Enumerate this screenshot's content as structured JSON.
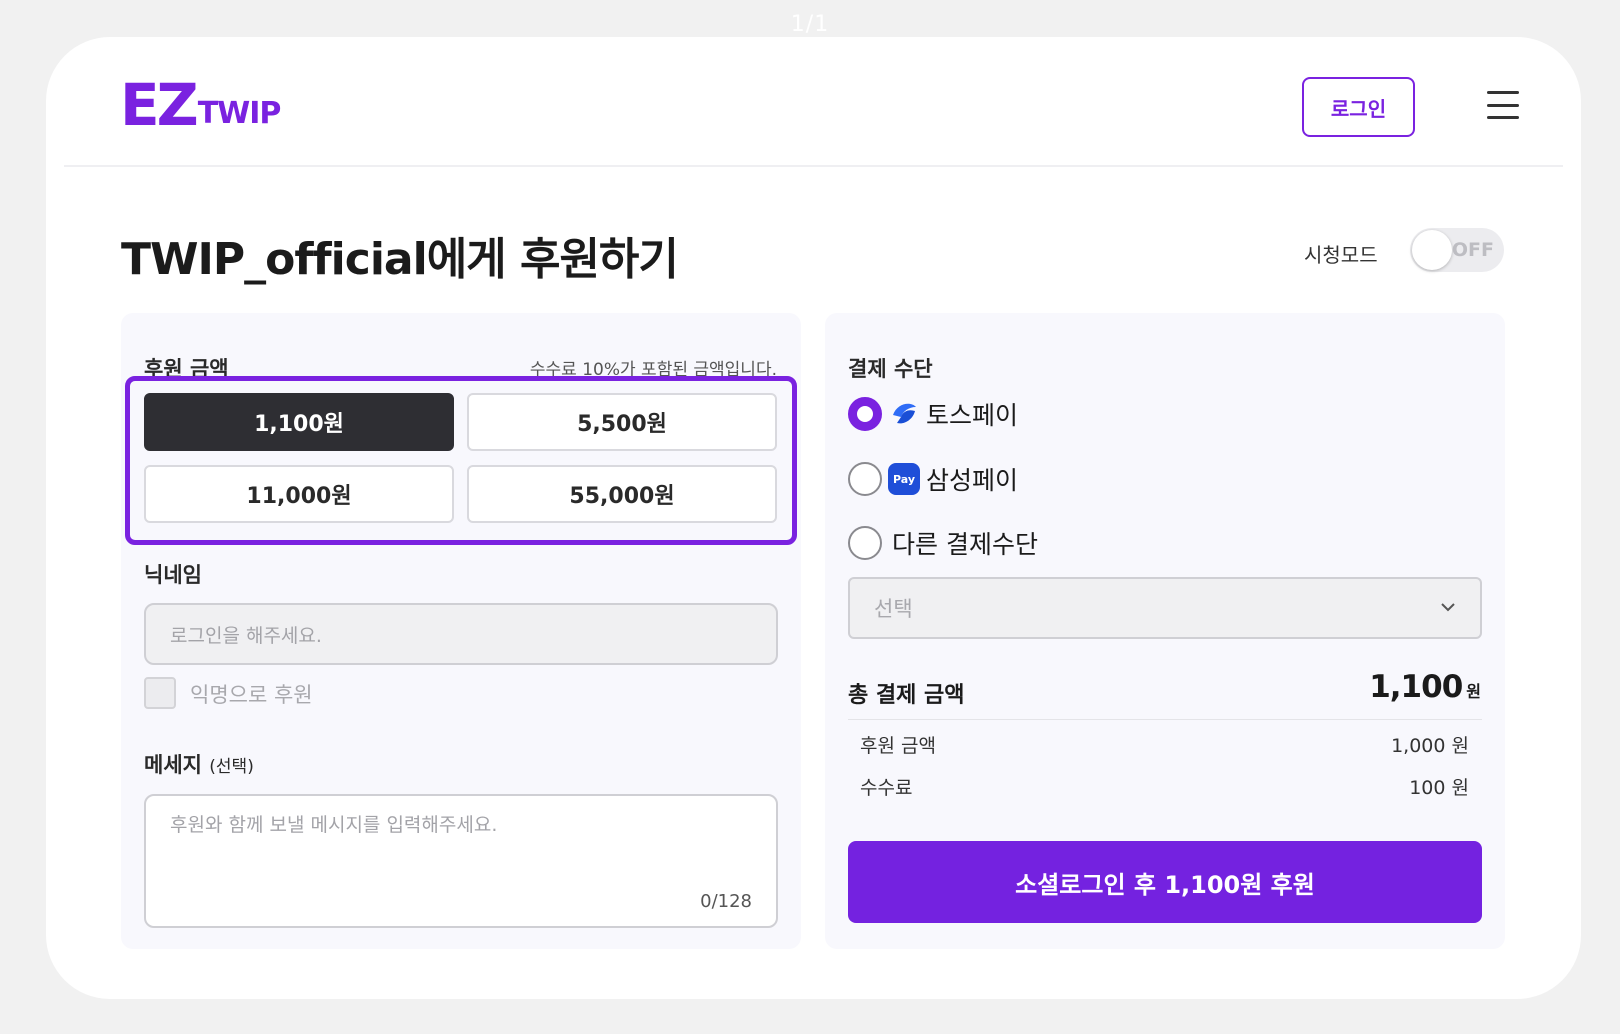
{
  "page_indicator": "1/1",
  "header": {
    "logo_big": "EZ",
    "logo_small": "TWIP",
    "login_label": "로그인"
  },
  "title": "TWIP_official에게 후원하기",
  "viewer_mode": {
    "label": "시청모드",
    "state": "OFF"
  },
  "donation": {
    "amount_label": "후원 금액",
    "fee_note": "수수료 10%가 포함된 금액입니다.",
    "amounts": [
      "1,100원",
      "5,500원",
      "11,000원",
      "55,000원"
    ],
    "selected_index": 0
  },
  "nickname": {
    "label": "닉네임",
    "placeholder": "로그인을 해주세요.",
    "anonymous_label": "익명으로 후원"
  },
  "message": {
    "label": "메세지",
    "optional": "(선택)",
    "placeholder": "후원와 함께 보낼 메시지를 입력해주세요.",
    "char_count": "0/128"
  },
  "payment": {
    "label": "결제 수단",
    "methods": [
      {
        "label": "토스페이",
        "icon": "toss-icon",
        "checked": true
      },
      {
        "label": "삼성페이",
        "icon": "samsung-pay-icon",
        "icon_text": "Pay",
        "checked": false
      },
      {
        "label": "다른 결제수단",
        "checked": false
      }
    ],
    "select_placeholder": "선택"
  },
  "summary": {
    "total_label": "총 결제 금액",
    "total_value": "1,100",
    "total_unit": "원",
    "rows": [
      {
        "label": "후원 금액",
        "value": "1,000 원"
      },
      {
        "label": "수수료",
        "value": "100 원"
      }
    ]
  },
  "submit_label": "소셜로그인 후 1,100원 후원",
  "colors": {
    "accent": "#7a22e0",
    "selected_amount_bg": "#2e2e33",
    "panel_bg": "#f8f8fd",
    "samsung_blue": "#1f4ed8"
  }
}
